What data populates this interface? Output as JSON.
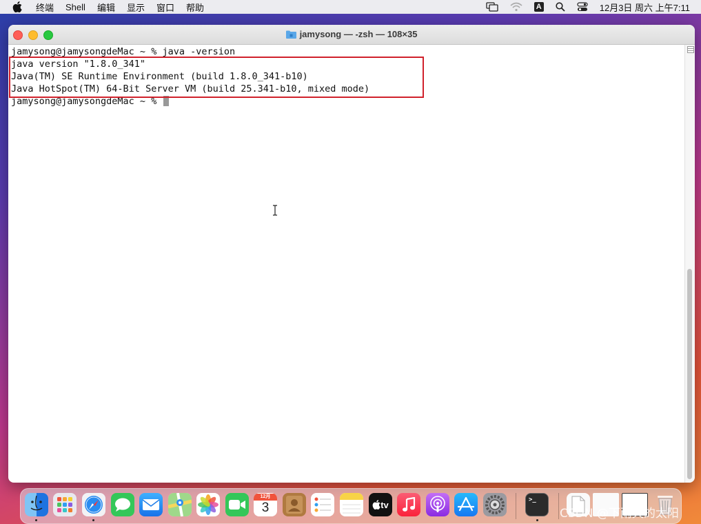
{
  "menubar": {
    "items": [
      "终端",
      "Shell",
      "编辑",
      "显示",
      "窗口",
      "帮助"
    ],
    "clock": "12月3日 周六 上午7:11",
    "input_method": "A"
  },
  "window": {
    "title": "jamysong — -zsh — 108×35"
  },
  "terminal": {
    "lines": [
      "jamysong@jamysongdeMac ~ % java -version",
      "java version \"1.8.0_341\"",
      "Java(TM) SE Runtime Environment (build 1.8.0_341-b10)",
      "Java HotSpot(TM) 64-Bit Server VM (build 25.341-b10, mixed mode)",
      "jamysong@jamysongdeMac ~ % "
    ]
  },
  "dock": {
    "calendar_month": "12月",
    "calendar_day": "3",
    "tv_label": "tv",
    "terminal_prompt": ">_"
  },
  "watermark": "CSDN @下雨天的太阳",
  "colors": {
    "highlight_box": "#d0202a",
    "close": "#fe5f57",
    "minimize": "#febc2e",
    "zoom": "#28c840"
  }
}
